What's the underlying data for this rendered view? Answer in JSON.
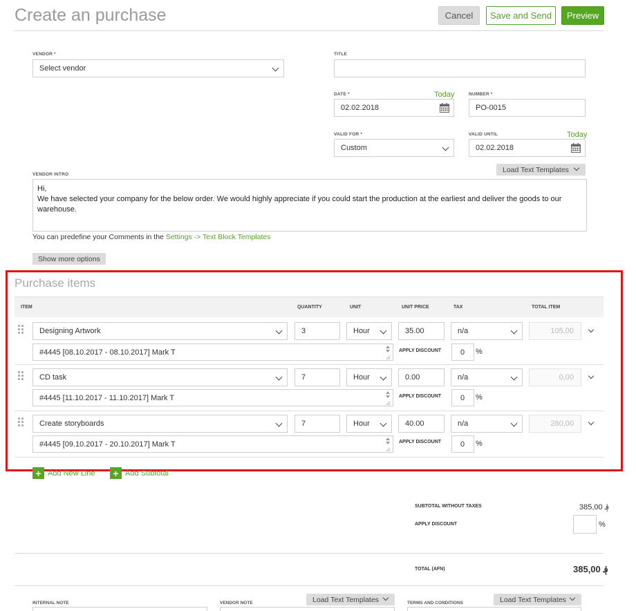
{
  "header": {
    "title": "Create an purchase",
    "cancel_label": "Cancel",
    "save_send_label": "Save and Send",
    "preview_label": "Preview"
  },
  "form": {
    "vendor_label": "VENDOR *",
    "vendor_value": "Select vendor",
    "title_label": "TITLE",
    "title_value": "",
    "date_label": "DATE *",
    "date_today": "Today",
    "date_value": "02.02.2018",
    "number_label": "NUMBER *",
    "number_value": "PO-0015",
    "valid_for_label": "VALID FOR *",
    "valid_for_value": "Custom",
    "valid_until_label": "VALID UNTIL",
    "valid_until_today": "Today",
    "valid_until_value": "02.02.2018",
    "load_templates_label": "Load Text Templates",
    "vendor_intro_label": "VENDOR INTRO",
    "vendor_intro_line1": "Hi,",
    "vendor_intro_line2": "We have selected your company for the below order. We would highly appreciate if you could start the production at the earliest and deliver the goods to our warehouse.",
    "predefine_text": "You can predefine your Comments in the",
    "predefine_link": "Settings -> Text Block Templates",
    "show_more_label": "Show more options"
  },
  "items_section": {
    "title": "Purchase items",
    "columns": {
      "item": "ITEM",
      "quantity": "QUANTITY",
      "unit": "UNIT",
      "unit_price": "UNIT PRICE",
      "tax": "TAX",
      "total_item": "TOTAL ITEM"
    },
    "apply_discount_label": "APPLY DISCOUNT",
    "percent_sign": "%",
    "rows": [
      {
        "item": "Designing Artwork",
        "quantity": "3",
        "unit": "Hour",
        "unit_price": "35.00",
        "tax": "n/a",
        "total": "105,00",
        "description": "#4445 [08.10.2017 - 08.10.2017] Mark T",
        "discount": "0"
      },
      {
        "item": "CD task",
        "quantity": "7",
        "unit": "Hour",
        "unit_price": "0.00",
        "tax": "n/a",
        "total": "0,00",
        "description": "#4445 [11.10.2017 - 11.10.2017] Mark T",
        "discount": "0"
      },
      {
        "item": "Create storyboards",
        "quantity": "7",
        "unit": "Hour",
        "unit_price": "40.00",
        "tax": "n/a",
        "total": "280,00",
        "description": "#4445 [09.10.2017 - 20.10.2017] Mark T",
        "discount": "0"
      }
    ],
    "add_new_line_label": "Add New Line",
    "add_subtotal_label": "Add Subtotal"
  },
  "summary": {
    "subtotal_label": "SUBTOTAL WITHOUT TAXES",
    "subtotal_value": "385,00 ؋",
    "apply_discount_label": "APPLY DISCOUNT",
    "discount_value": "",
    "percent_sign": "%",
    "total_label": "TOTAL (AFN)",
    "total_value": "385,00 ؋"
  },
  "bottom": {
    "internal_note_label": "INTERNAL NOTE",
    "vendor_note_label": "VENDOR NOTE",
    "terms_label": "TERMS AND CONDITIONS",
    "load_templates_label_1": "Load Text Templates",
    "load_templates_label_2": "Load Text Templates"
  },
  "colors": {
    "accent_green": "#55a622",
    "highlight_red": "#e0141b"
  }
}
